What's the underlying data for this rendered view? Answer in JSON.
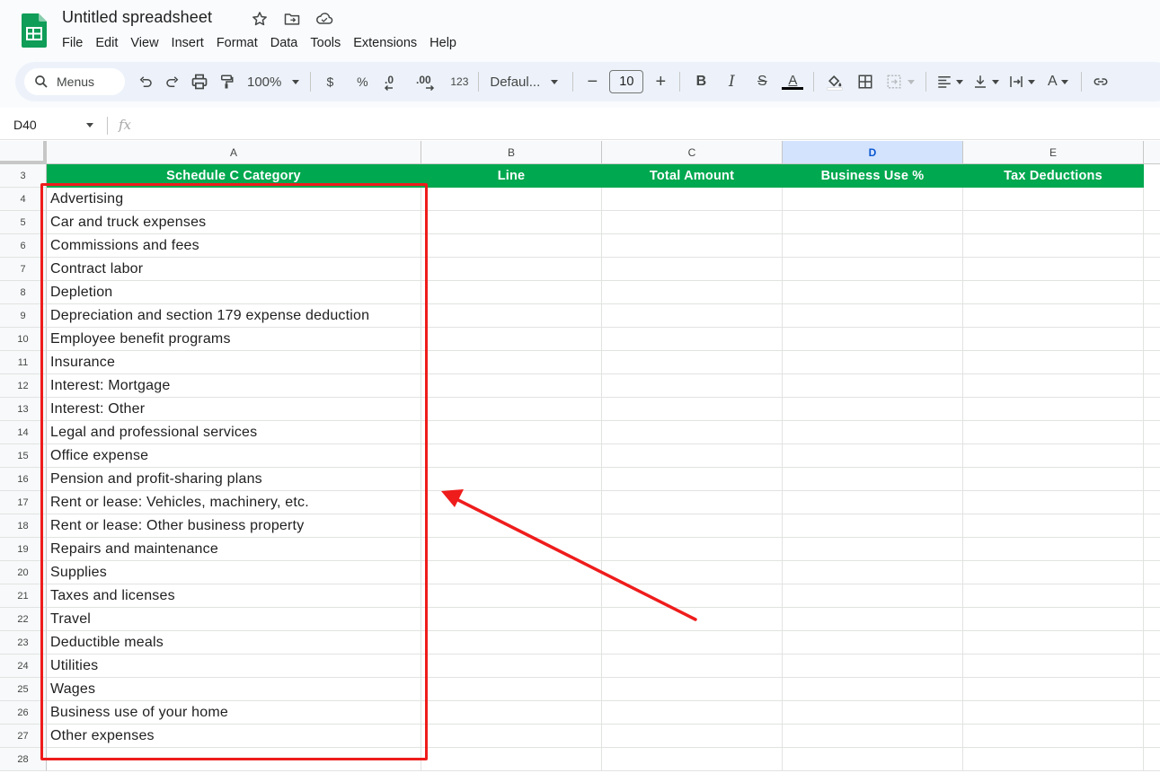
{
  "app": {
    "doc_title": "Untitled spreadsheet",
    "menu": [
      "File",
      "Edit",
      "View",
      "Insert",
      "Format",
      "Data",
      "Tools",
      "Extensions",
      "Help"
    ]
  },
  "toolbar": {
    "search_label": "Menus",
    "zoom": "100%",
    "currency": "$",
    "percent": "%",
    "decrease_decimal": ".0",
    "increase_decimal": ".00",
    "number_format": "123",
    "font": "Defaul...",
    "font_size": "10",
    "minus": "−",
    "plus": "+",
    "bold": "B",
    "italic": "I",
    "strike": "S",
    "text_color_letter": "A",
    "text_rotation_letter": "A"
  },
  "formula_bar": {
    "name_box": "D40",
    "fx": "fx"
  },
  "columns": [
    "A",
    "B",
    "C",
    "D",
    "E"
  ],
  "selected_column": "D",
  "header_row": {
    "row_number": "3",
    "cells": [
      "Schedule C Category",
      "Line",
      "Total Amount",
      "Business Use %",
      "Tax Deductions"
    ]
  },
  "rows": [
    {
      "n": "4",
      "a": "Advertising"
    },
    {
      "n": "5",
      "a": "Car and truck expenses"
    },
    {
      "n": "6",
      "a": "Commissions and fees"
    },
    {
      "n": "7",
      "a": "Contract labor"
    },
    {
      "n": "8",
      "a": "Depletion"
    },
    {
      "n": "9",
      "a": "Depreciation and section 179 expense deduction"
    },
    {
      "n": "10",
      "a": "Employee benefit programs"
    },
    {
      "n": "11",
      "a": "Insurance"
    },
    {
      "n": "12",
      "a": "Interest: Mortgage"
    },
    {
      "n": "13",
      "a": "Interest: Other"
    },
    {
      "n": "14",
      "a": "Legal and professional services"
    },
    {
      "n": "15",
      "a": "Office expense"
    },
    {
      "n": "16",
      "a": "Pension and profit-sharing plans"
    },
    {
      "n": "17",
      "a": "Rent or lease: Vehicles, machinery, etc."
    },
    {
      "n": "18",
      "a": "Rent or lease: Other business property"
    },
    {
      "n": "19",
      "a": "Repairs and maintenance"
    },
    {
      "n": "20",
      "a": "Supplies"
    },
    {
      "n": "21",
      "a": "Taxes and licenses"
    },
    {
      "n": "22",
      "a": "Travel"
    },
    {
      "n": "23",
      "a": "Deductible meals"
    },
    {
      "n": "24",
      "a": "Utilities"
    },
    {
      "n": "25",
      "a": "Wages"
    },
    {
      "n": "26",
      "a": "Business use of your home"
    },
    {
      "n": "27",
      "a": "Other expenses"
    },
    {
      "n": "28",
      "a": ""
    }
  ],
  "colors": {
    "header_green": "#00a84f",
    "annotation_red": "#ef1c1c",
    "selected_col_bg": "#d3e3fd"
  }
}
